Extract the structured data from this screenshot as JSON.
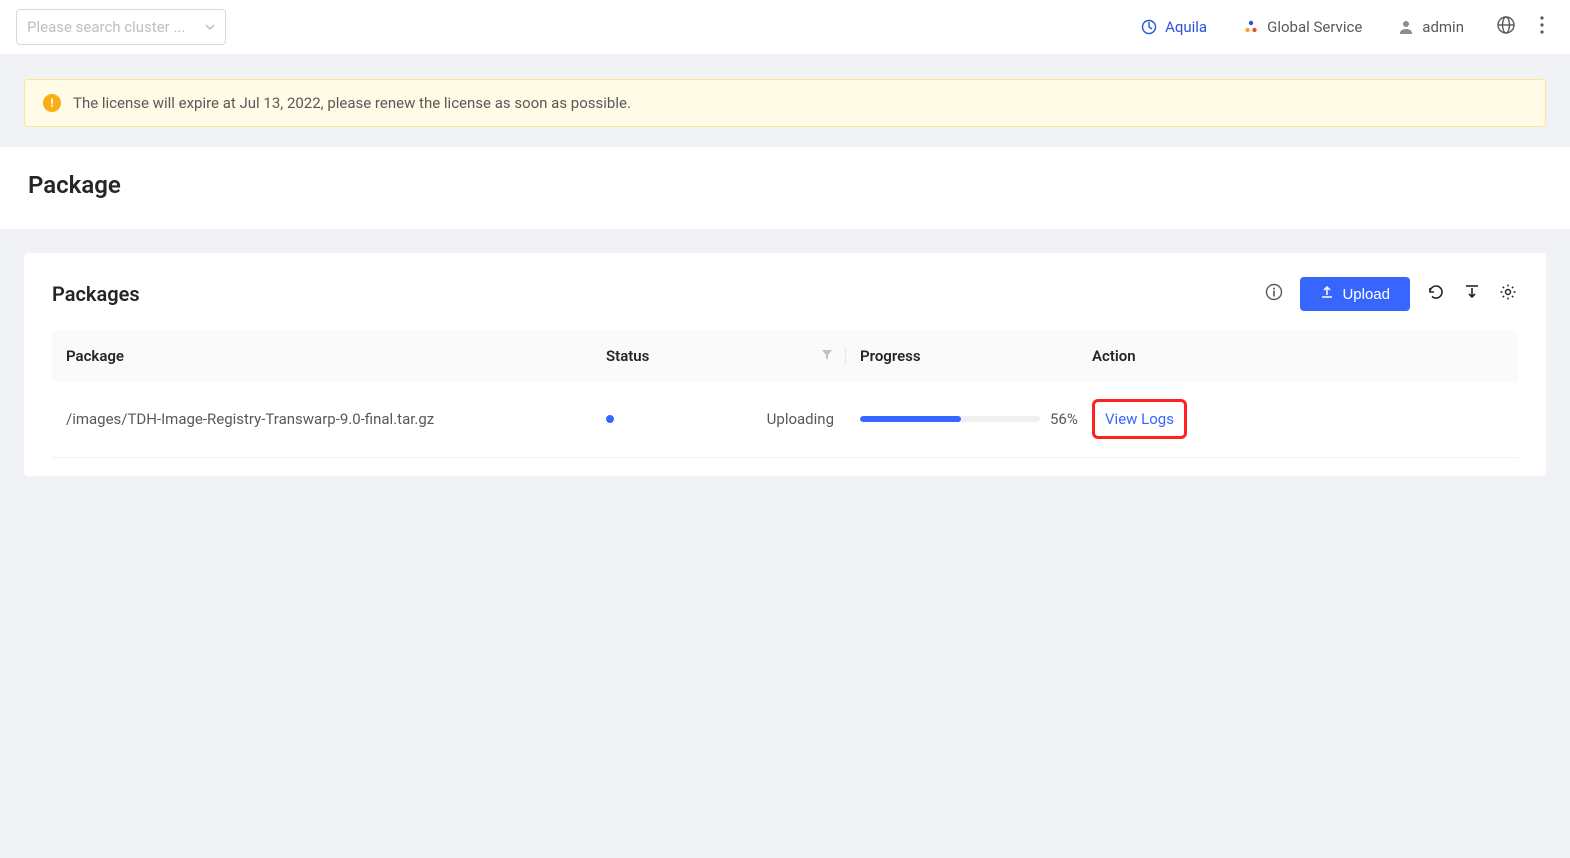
{
  "header": {
    "search_placeholder": "Please search cluster ...",
    "nav": {
      "aquila": "Aquila",
      "global_service": "Global Service",
      "admin": "admin"
    }
  },
  "alert": {
    "message": "The license will expire at Jul 13, 2022, please renew the license as soon as possible."
  },
  "page": {
    "title": "Package"
  },
  "card": {
    "title": "Packages",
    "upload_label": "Upload"
  },
  "table": {
    "headers": {
      "package": "Package",
      "status": "Status",
      "progress": "Progress",
      "action": "Action"
    },
    "rows": [
      {
        "package": "/images/TDH-Image-Registry-Transwarp-9.0-final.tar.gz",
        "status": "Uploading",
        "status_color": "#3766ff",
        "progress_percent": 56,
        "progress_label": "56%",
        "action_label": "View Logs"
      }
    ]
  }
}
